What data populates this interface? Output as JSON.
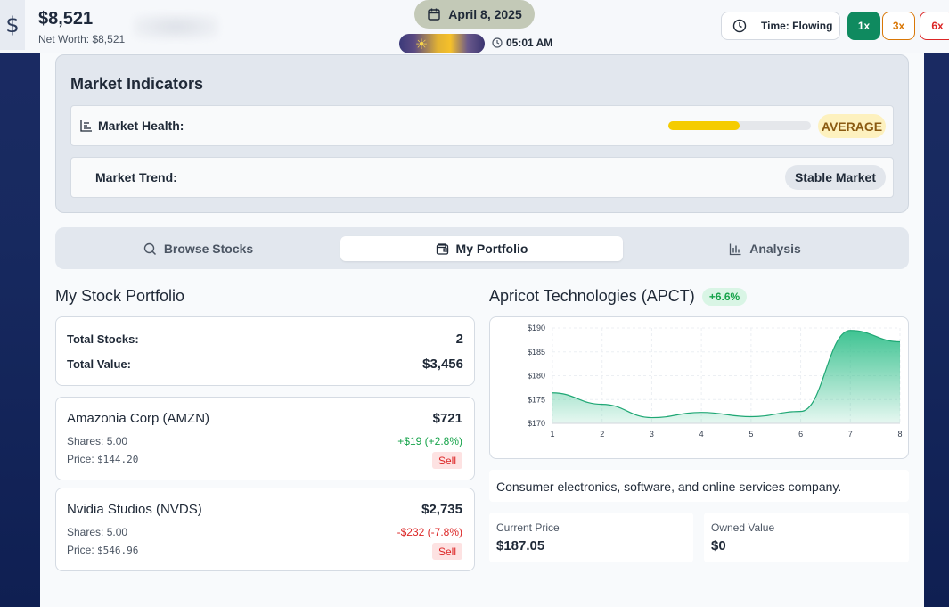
{
  "header": {
    "cash": "$8,521",
    "networth": "Net Worth: $8,521",
    "date": "April 8, 2025",
    "clock": "05:01 AM",
    "time_mode": "Time: Flowing",
    "speeds": [
      "1x",
      "3x",
      "6x"
    ],
    "active_speed": "1x",
    "icons": {
      "money": "dollar-icon",
      "date": "calendar-icon",
      "clock": "clock-icon",
      "sun": "sun-icon"
    }
  },
  "indicators": {
    "title": "Market Indicators",
    "health_label": "Market Health:",
    "health_level": 0.5,
    "health_status": "AVERAGE",
    "trend_label": "Market Trend:",
    "trend_status": "Stable Market",
    "colors": {
      "health_fill": "#f5cc00",
      "health_badge_bg": "#fdf1bf",
      "health_badge_text": "#8a5a12"
    }
  },
  "tabs": [
    {
      "label": "Browse Stocks",
      "icon": "search-icon"
    },
    {
      "label": "My Portfolio",
      "icon": "wallet-icon",
      "active": true
    },
    {
      "label": "Analysis",
      "icon": "bar-chart-icon"
    }
  ],
  "portfolio": {
    "title": "My Stock Portfolio",
    "total_stocks_label": "Total Stocks:",
    "total_stocks": "2",
    "total_value_label": "Total Value:",
    "total_value": "$3,456",
    "holdings": [
      {
        "name": "Amazonia Corp (AMZN)",
        "value": "$721",
        "shares_label": "Shares:",
        "shares": "5.00",
        "price_label": "Price:",
        "price": "$144.20",
        "change": "+$19 (+2.8%)",
        "direction": "up",
        "sell": "Sell"
      },
      {
        "name": "Nvidia Studios (NVDS)",
        "value": "$2,735",
        "shares_label": "Shares:",
        "shares": "5.00",
        "price_label": "Price:",
        "price": "$546.96",
        "change": "-$232 (-7.8%)",
        "direction": "down",
        "sell": "Sell"
      }
    ]
  },
  "details": {
    "title": "Apricot Technologies (APCT)",
    "change_badge": "+6.6%",
    "description": "Consumer electronics, software, and online services company.",
    "current_price_label": "Current Price",
    "current_price": "$187.05",
    "owned_value_label": "Owned Value",
    "owned_value": "$0"
  },
  "chart_data": {
    "type": "area",
    "x": [
      1,
      2,
      3,
      4,
      5,
      6,
      7,
      8
    ],
    "values": [
      176.4,
      174.0,
      171.2,
      172.3,
      171.4,
      172.5,
      189.5,
      187.1
    ],
    "ylim": [
      170,
      190
    ],
    "yticks": [
      "$170",
      "$175",
      "$180",
      "$185",
      "$190"
    ],
    "xticks": [
      "1",
      "2",
      "3",
      "4",
      "5",
      "6",
      "7",
      "8"
    ],
    "grid": true,
    "color": "#34c08c"
  }
}
